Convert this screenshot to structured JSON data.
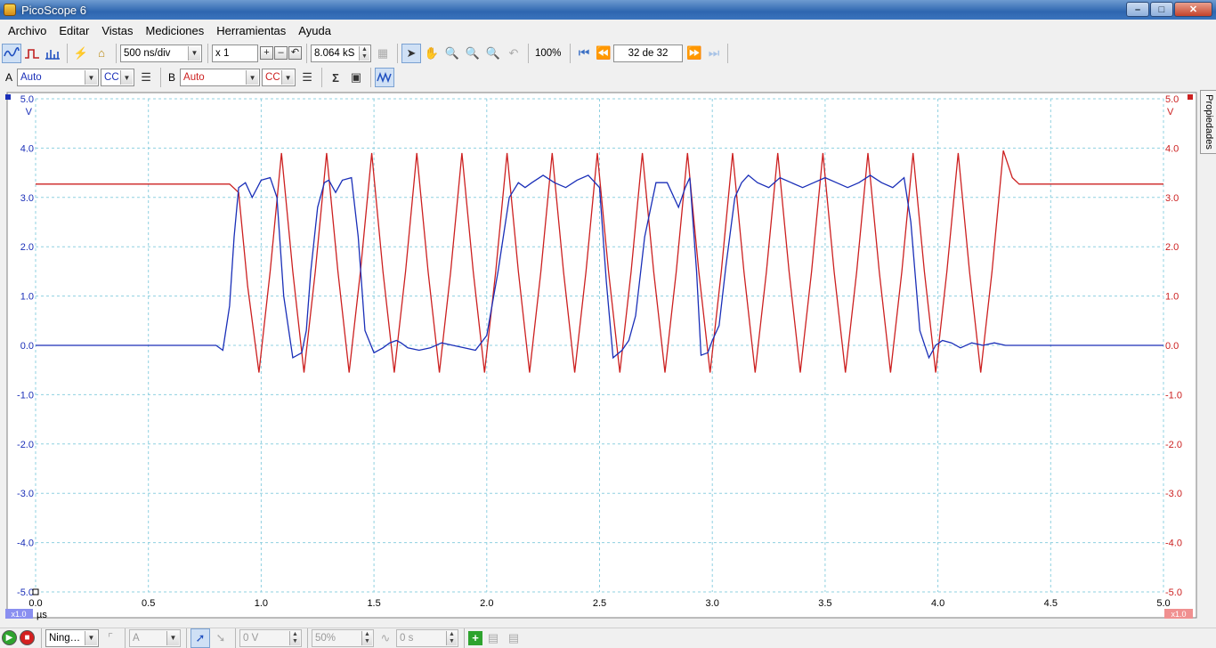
{
  "window": {
    "title": "PicoScope 6"
  },
  "menu": [
    "Archivo",
    "Editar",
    "Vistas",
    "Mediciones",
    "Herramientas",
    "Ayuda"
  ],
  "toolbar": {
    "timebase": "500 ns/div",
    "zoom_factor": "x 1",
    "samples": "8.064 kS",
    "zoom_percent": "100%",
    "buffer_position": "32 de 32"
  },
  "channels": {
    "a": {
      "label": "A",
      "range": "Auto",
      "coupling": "CC",
      "color": "#1a2fb8"
    },
    "b": {
      "label": "B",
      "range": "Auto",
      "coupling": "CC",
      "color": "#cc2020"
    }
  },
  "side_tab": {
    "label": "Propiedades"
  },
  "scope": {
    "x_unit": "µs",
    "x_ticks": [
      "0.0",
      "0.5",
      "1.0",
      "1.5",
      "2.0",
      "2.5",
      "3.0",
      "3.5",
      "4.0",
      "4.5",
      "5.0"
    ],
    "y_unit_left": "V",
    "y_unit_right": "V",
    "y_ticks": [
      "5.0",
      "4.0",
      "3.0",
      "2.0",
      "1.0",
      "0.0",
      "-1.0",
      "-2.0",
      "-3.0",
      "-4.0",
      "-5.0"
    ],
    "scale_badge_left": "x1.0",
    "scale_badge_right": "x1.0"
  },
  "chart_data": {
    "type": "line",
    "title": "",
    "xlabel": "µs",
    "ylabel": "V",
    "xlim": [
      0,
      5
    ],
    "ylim": [
      -5,
      5
    ],
    "grid": true,
    "series": [
      {
        "name": "A",
        "color": "#1a2fb8",
        "x": [
          0,
          0.8,
          0.83,
          0.86,
          0.88,
          0.9,
          0.93,
          0.96,
          1.0,
          1.04,
          1.07,
          1.1,
          1.14,
          1.18,
          1.2,
          1.22,
          1.25,
          1.28,
          1.3,
          1.33,
          1.36,
          1.4,
          1.43,
          1.46,
          1.5,
          1.54,
          1.57,
          1.6,
          1.62,
          1.65,
          1.7,
          1.75,
          1.8,
          1.85,
          1.9,
          1.95,
          2.0,
          2.05,
          2.1,
          2.14,
          2.17,
          2.2,
          2.25,
          2.3,
          2.35,
          2.4,
          2.45,
          2.5,
          2.53,
          2.56,
          2.6,
          2.63,
          2.66,
          2.7,
          2.75,
          2.8,
          2.85,
          2.88,
          2.9,
          2.93,
          2.95,
          2.98,
          3.0,
          3.03,
          3.06,
          3.1,
          3.13,
          3.16,
          3.2,
          3.25,
          3.3,
          3.35,
          3.4,
          3.45,
          3.5,
          3.55,
          3.6,
          3.65,
          3.7,
          3.75,
          3.8,
          3.85,
          3.88,
          3.92,
          3.96,
          3.99,
          4.02,
          4.06,
          4.1,
          4.15,
          4.2,
          4.25,
          4.3,
          4.33,
          5.0
        ],
        "y": [
          0,
          0,
          -0.1,
          0.8,
          2.2,
          3.2,
          3.3,
          3.0,
          3.35,
          3.4,
          3.0,
          1.0,
          -0.25,
          -0.15,
          0.3,
          1.5,
          2.8,
          3.3,
          3.35,
          3.1,
          3.35,
          3.4,
          2.2,
          0.3,
          -0.15,
          -0.05,
          0.05,
          0.1,
          0.05,
          -0.05,
          -0.1,
          -0.05,
          0.05,
          0.0,
          -0.05,
          -0.1,
          0.2,
          1.5,
          3.0,
          3.3,
          3.2,
          3.3,
          3.45,
          3.3,
          3.2,
          3.35,
          3.45,
          3.2,
          1.3,
          -0.25,
          -0.1,
          0.1,
          0.6,
          2.2,
          3.3,
          3.3,
          2.8,
          3.2,
          3.4,
          1.5,
          -0.2,
          -0.15,
          0.1,
          0.4,
          1.6,
          3.0,
          3.3,
          3.45,
          3.3,
          3.2,
          3.4,
          3.3,
          3.2,
          3.3,
          3.4,
          3.3,
          3.2,
          3.3,
          3.45,
          3.3,
          3.2,
          3.4,
          2.5,
          0.3,
          -0.25,
          0.0,
          0.1,
          0.05,
          -0.05,
          0.05,
          0.0,
          0.05,
          0.0,
          0.0,
          0.0
        ]
      },
      {
        "name": "B",
        "color": "#cc2020",
        "x": [
          0,
          0.86,
          0.9,
          0.94,
          0.99,
          1.04,
          1.09,
          1.14,
          1.19,
          1.24,
          1.29,
          1.34,
          1.39,
          1.44,
          1.49,
          1.54,
          1.59,
          1.64,
          1.69,
          1.74,
          1.79,
          1.84,
          1.89,
          1.94,
          1.99,
          2.04,
          2.09,
          2.14,
          2.19,
          2.24,
          2.29,
          2.34,
          2.39,
          2.44,
          2.49,
          2.54,
          2.59,
          2.64,
          2.69,
          2.74,
          2.79,
          2.84,
          2.89,
          2.94,
          2.99,
          3.04,
          3.09,
          3.14,
          3.19,
          3.24,
          3.29,
          3.34,
          3.39,
          3.44,
          3.49,
          3.54,
          3.59,
          3.64,
          3.69,
          3.74,
          3.79,
          3.84,
          3.89,
          3.94,
          3.99,
          4.04,
          4.09,
          4.14,
          4.19,
          4.24,
          4.29,
          4.33,
          4.36,
          5.0
        ],
        "y": [
          3.27,
          3.27,
          3.1,
          1.2,
          -0.55,
          1.5,
          3.9,
          1.5,
          -0.55,
          1.5,
          3.9,
          1.5,
          -0.55,
          1.5,
          3.9,
          1.5,
          -0.55,
          1.5,
          3.9,
          1.5,
          -0.55,
          1.5,
          3.9,
          1.5,
          -0.55,
          1.5,
          3.9,
          1.5,
          -0.55,
          1.5,
          3.9,
          1.5,
          -0.55,
          1.5,
          3.9,
          1.5,
          -0.55,
          1.5,
          3.9,
          1.5,
          -0.55,
          1.5,
          3.9,
          1.5,
          -0.55,
          1.5,
          3.9,
          1.5,
          -0.55,
          1.5,
          3.9,
          1.5,
          -0.55,
          1.5,
          3.9,
          1.5,
          -0.55,
          1.5,
          3.9,
          1.5,
          -0.55,
          1.5,
          3.9,
          1.5,
          -0.55,
          1.5,
          3.9,
          1.5,
          -0.55,
          1.5,
          3.95,
          3.4,
          3.27,
          3.27
        ]
      }
    ]
  },
  "statusbar": {
    "trigger_mode": "Ning…",
    "trigger_source": "A",
    "threshold": "0 V",
    "pretrigger": "50%",
    "delay": "0 s"
  }
}
